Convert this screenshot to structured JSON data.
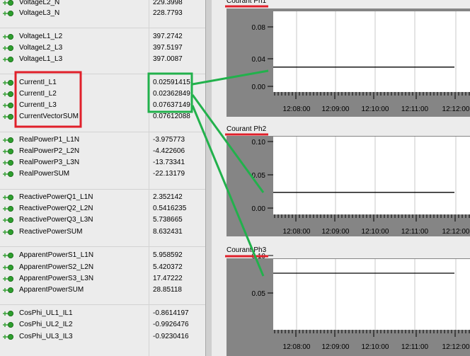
{
  "rows": [
    {
      "name": "VoltageL2_N",
      "value": "229.3998"
    },
    {
      "name": "VoltageL3_N",
      "value": "228.7793"
    },
    {
      "name": "VoltageL1_L2",
      "value": "397.2742"
    },
    {
      "name": "VoltageL2_L3",
      "value": "397.5197"
    },
    {
      "name": "VoltageL1_L3",
      "value": "397.0087"
    },
    {
      "name": "CurrentI_L1",
      "value": "0.02591415"
    },
    {
      "name": "CurrentI_L2",
      "value": "0.02362849"
    },
    {
      "name": "CurrentI_L3",
      "value": "0.07637149"
    },
    {
      "name": "CurrentVectorSUM",
      "value": "0.07612088"
    },
    {
      "name": "RealPowerP1_L1N",
      "value": "-3.975773"
    },
    {
      "name": "RealPowerP2_L2N",
      "value": "-4.422606"
    },
    {
      "name": "RealPowerP3_L3N",
      "value": "-13.73341"
    },
    {
      "name": "RealPowerSUM",
      "value": "-22.13179"
    },
    {
      "name": "ReactivePowerQ1_L1N",
      "value": "2.352142"
    },
    {
      "name": "ReactivePowerQ2_L2N",
      "value": "0.5416235"
    },
    {
      "name": "ReactivePowerQ3_L3N",
      "value": "5.738665"
    },
    {
      "name": "ReactivePowerSUM",
      "value": "8.632431"
    },
    {
      "name": "ApparentPowerS1_L1N",
      "value": "5.958592"
    },
    {
      "name": "ApparentPowerS2_L2N",
      "value": "5.420372"
    },
    {
      "name": "ApparentPowerS3_L3N",
      "value": "17.47222"
    },
    {
      "name": "ApparentPowerSUM",
      "value": "28.85118"
    },
    {
      "name": "CosPhi_UL1_IL1",
      "value": "-0.8614197"
    },
    {
      "name": "CosPhi_UL2_IL2",
      "value": "-0.9926476"
    },
    {
      "name": "CosPhi_UL3_IL3",
      "value": "-0.9230416"
    }
  ],
  "colors": {
    "row_icon_green": "#2e9e2e",
    "highlight_red": "#e0202a",
    "highlight_green": "#22b14c",
    "plot_axis_bg": "#858585",
    "plot_bg": "#ffffff",
    "trace": "#000000"
  },
  "icons": {
    "row": "green-plus-link-icon"
  },
  "charts": [
    {
      "title": "Courant Ph1"
    },
    {
      "title": "Courant Ph2"
    },
    {
      "title": "Courant Ph3"
    }
  ],
  "chart_data": [
    {
      "type": "line",
      "title": "Courant Ph1",
      "x": [
        "12:08:00",
        "12:09:00",
        "12:10:00",
        "12:11:00",
        "12:12:00"
      ],
      "yticks": [
        "0.08",
        "0.04",
        "0.00"
      ],
      "ylim": [
        0,
        0.1
      ],
      "series": [
        {
          "values": [
            0.0259,
            0.0259,
            0.0259,
            0.0259,
            0.0259
          ]
        }
      ]
    },
    {
      "type": "line",
      "title": "Courant Ph2",
      "x": [
        "12:08:00",
        "12:09:00",
        "12:10:00",
        "12:11:00",
        "12:12:00"
      ],
      "yticks": [
        "0.10",
        "0.05",
        "0.00"
      ],
      "ylim": [
        0,
        0.105
      ],
      "series": [
        {
          "values": [
            0.0236,
            0.0236,
            0.0236,
            0.0236,
            0.0236
          ]
        }
      ]
    },
    {
      "type": "line",
      "title": "Courant Ph3",
      "x": [
        "12:08:00",
        "12:09:00",
        "12:10:00",
        "12:11:00",
        "12:12:00"
      ],
      "yticks": [
        "0.10",
        "0.05"
      ],
      "ylim": [
        0,
        0.105
      ],
      "series": [
        {
          "values": [
            0.0764,
            0.0764,
            0.0764,
            0.0764,
            0.0764
          ]
        }
      ]
    }
  ]
}
